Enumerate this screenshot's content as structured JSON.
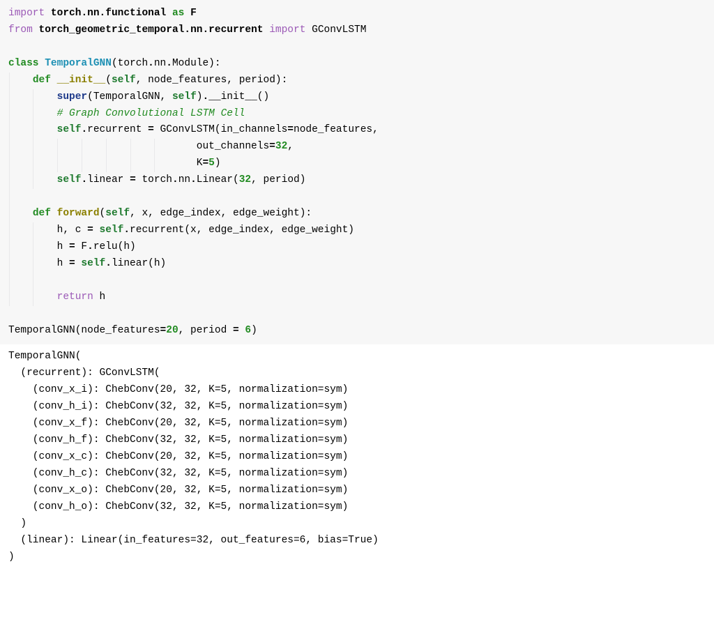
{
  "code": {
    "lines": [
      {
        "depth": 0,
        "tokens": [
          [
            "kw-import",
            "import"
          ],
          [
            "plain",
            " "
          ],
          [
            "mod",
            "torch"
          ],
          [
            "plain-b",
            "."
          ],
          [
            "mod",
            "nn"
          ],
          [
            "plain-b",
            "."
          ],
          [
            "mod",
            "functional"
          ],
          [
            "plain",
            " "
          ],
          [
            "kw-green",
            "as"
          ],
          [
            "plain",
            " "
          ],
          [
            "mod",
            "F"
          ]
        ]
      },
      {
        "depth": 0,
        "tokens": [
          [
            "kw-import",
            "from"
          ],
          [
            "plain",
            " "
          ],
          [
            "mod",
            "torch_geometric_temporal"
          ],
          [
            "plain-b",
            "."
          ],
          [
            "mod",
            "nn"
          ],
          [
            "plain-b",
            "."
          ],
          [
            "mod",
            "recurrent"
          ],
          [
            "plain",
            " "
          ],
          [
            "kw-import",
            "import"
          ],
          [
            "plain",
            " "
          ],
          [
            "plain",
            "GConvLSTM"
          ]
        ]
      },
      {
        "depth": 0,
        "tokens": [
          [
            "plain",
            ""
          ]
        ]
      },
      {
        "depth": 0,
        "tokens": [
          [
            "kw-green",
            "class"
          ],
          [
            "plain",
            " "
          ],
          [
            "cls-name",
            "TemporalGNN"
          ],
          [
            "plain",
            "("
          ],
          [
            "plain",
            "torch"
          ],
          [
            "plain-b",
            "."
          ],
          [
            "plain",
            "nn"
          ],
          [
            "plain-b",
            "."
          ],
          [
            "plain",
            "Module):"
          ]
        ]
      },
      {
        "depth": 1,
        "tokens": [
          [
            "plain",
            "    "
          ],
          [
            "kw-green",
            "def"
          ],
          [
            "plain",
            " "
          ],
          [
            "fn-name",
            "__init__"
          ],
          [
            "plain",
            "("
          ],
          [
            "self",
            "self"
          ],
          [
            "plain",
            ", node_features, period):"
          ]
        ]
      },
      {
        "depth": 2,
        "tokens": [
          [
            "plain",
            "        "
          ],
          [
            "kw-blue",
            "super"
          ],
          [
            "plain",
            "(TemporalGNN, "
          ],
          [
            "self",
            "self"
          ],
          [
            "plain",
            ")"
          ],
          [
            "plain-b",
            "."
          ],
          [
            "plain",
            "__init__()"
          ]
        ]
      },
      {
        "depth": 2,
        "tokens": [
          [
            "plain",
            "        "
          ],
          [
            "comment",
            "# Graph Convolutional LSTM Cell"
          ]
        ]
      },
      {
        "depth": 2,
        "tokens": [
          [
            "plain",
            "        "
          ],
          [
            "self",
            "self"
          ],
          [
            "plain-b",
            "."
          ],
          [
            "plain",
            "recurrent "
          ],
          [
            "plain-b",
            "="
          ],
          [
            "plain",
            " GConvLSTM(in_channels"
          ],
          [
            "plain-b",
            "="
          ],
          [
            "plain",
            "node_features,"
          ]
        ]
      },
      {
        "depth": 7,
        "tokens": [
          [
            "plain",
            "                               out_channels"
          ],
          [
            "plain-b",
            "="
          ],
          [
            "num",
            "32"
          ],
          [
            "plain",
            ","
          ]
        ]
      },
      {
        "depth": 7,
        "tokens": [
          [
            "plain",
            "                               K"
          ],
          [
            "plain-b",
            "="
          ],
          [
            "num",
            "5"
          ],
          [
            "plain",
            ")"
          ]
        ]
      },
      {
        "depth": 2,
        "tokens": [
          [
            "plain",
            "        "
          ],
          [
            "self",
            "self"
          ],
          [
            "plain-b",
            "."
          ],
          [
            "plain",
            "linear "
          ],
          [
            "plain-b",
            "="
          ],
          [
            "plain",
            " torch"
          ],
          [
            "plain-b",
            "."
          ],
          [
            "plain",
            "nn"
          ],
          [
            "plain-b",
            "."
          ],
          [
            "plain",
            "Linear("
          ],
          [
            "num",
            "32"
          ],
          [
            "plain",
            ", period)"
          ]
        ]
      },
      {
        "depth": 1,
        "tokens": [
          [
            "plain",
            ""
          ]
        ]
      },
      {
        "depth": 1,
        "tokens": [
          [
            "plain",
            "    "
          ],
          [
            "kw-green",
            "def"
          ],
          [
            "plain",
            " "
          ],
          [
            "fn-name",
            "forward"
          ],
          [
            "plain",
            "("
          ],
          [
            "self",
            "self"
          ],
          [
            "plain",
            ", x, edge_index, edge_weight):"
          ]
        ]
      },
      {
        "depth": 2,
        "tokens": [
          [
            "plain",
            "        h, c "
          ],
          [
            "plain-b",
            "="
          ],
          [
            "plain",
            " "
          ],
          [
            "self",
            "self"
          ],
          [
            "plain-b",
            "."
          ],
          [
            "plain",
            "recurrent(x, edge_index, edge_weight)"
          ]
        ]
      },
      {
        "depth": 2,
        "tokens": [
          [
            "plain",
            "        h "
          ],
          [
            "plain-b",
            "="
          ],
          [
            "plain",
            " F"
          ],
          [
            "plain-b",
            "."
          ],
          [
            "plain",
            "relu(h)"
          ]
        ]
      },
      {
        "depth": 2,
        "tokens": [
          [
            "plain",
            "        h "
          ],
          [
            "plain-b",
            "="
          ],
          [
            "plain",
            " "
          ],
          [
            "self",
            "self"
          ],
          [
            "plain-b",
            "."
          ],
          [
            "plain",
            "linear(h)"
          ]
        ]
      },
      {
        "depth": 2,
        "tokens": [
          [
            "plain",
            ""
          ]
        ]
      },
      {
        "depth": 2,
        "tokens": [
          [
            "plain",
            "        "
          ],
          [
            "kw-import",
            "return"
          ],
          [
            "plain",
            " h"
          ]
        ]
      },
      {
        "depth": 0,
        "tokens": [
          [
            "plain",
            ""
          ]
        ]
      },
      {
        "depth": 0,
        "tokens": [
          [
            "plain",
            "TemporalGNN(node_features"
          ],
          [
            "plain-b",
            "="
          ],
          [
            "num",
            "20"
          ],
          [
            "plain",
            ", period "
          ],
          [
            "plain-b",
            "="
          ],
          [
            "plain",
            " "
          ],
          [
            "num",
            "6"
          ],
          [
            "plain",
            ")"
          ]
        ]
      }
    ]
  },
  "output": {
    "lines": [
      "TemporalGNN(",
      "  (recurrent): GConvLSTM(",
      "    (conv_x_i): ChebConv(20, 32, K=5, normalization=sym)",
      "    (conv_h_i): ChebConv(32, 32, K=5, normalization=sym)",
      "    (conv_x_f): ChebConv(20, 32, K=5, normalization=sym)",
      "    (conv_h_f): ChebConv(32, 32, K=5, normalization=sym)",
      "    (conv_x_c): ChebConv(20, 32, K=5, normalization=sym)",
      "    (conv_h_c): ChebConv(32, 32, K=5, normalization=sym)",
      "    (conv_x_o): ChebConv(20, 32, K=5, normalization=sym)",
      "    (conv_h_o): ChebConv(32, 32, K=5, normalization=sym)",
      "  )",
      "  (linear): Linear(in_features=32, out_features=6, bias=True)",
      ")"
    ]
  }
}
